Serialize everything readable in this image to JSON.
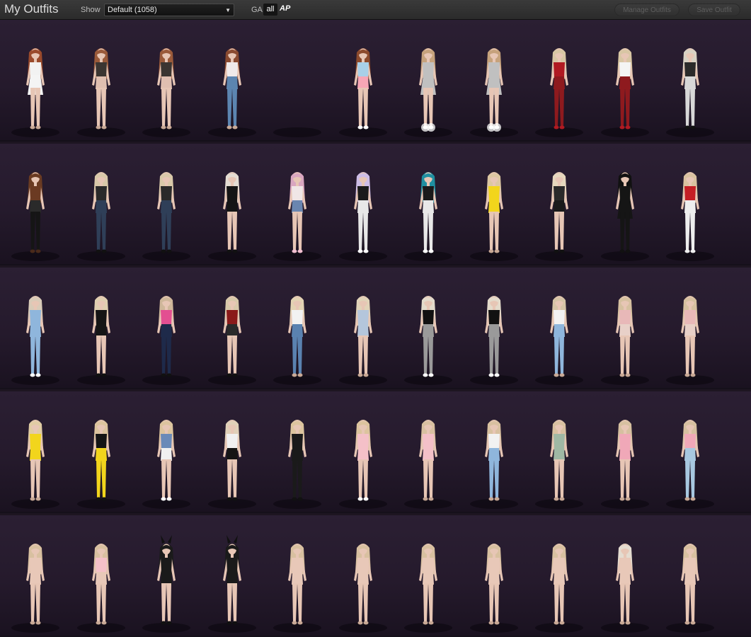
{
  "header": {
    "title": "My Outfits",
    "show_label": "Show",
    "show_value": "Default (1058)",
    "ga_label": "GA",
    "filter_all": "all",
    "filter_ap": "AP",
    "manage_label": "Manage Outfits",
    "save_label": "Save Outfit"
  },
  "colors": {
    "background": "#1d1521",
    "row": "#2b1f33",
    "skin": "#e7c6b5",
    "text": "#dcdcdc"
  },
  "rows": [
    {
      "outfits": [
        {
          "hair": "#9a4a2c",
          "top": "#f2f2f2",
          "bottom": "#f4f4f4",
          "legs": "skin",
          "shoes": "#c9a996",
          "dress": true
        },
        {
          "hair": "#9a5a3a",
          "top": "#3b3531",
          "bottom": "#e0bfb0",
          "legs": "skin",
          "shoes": "#c9a996"
        },
        {
          "hair": "#9a5a3a",
          "top": "#3b3531",
          "bottom": "#e0bfb0",
          "legs": "skin",
          "shoes": "#c9a996"
        },
        {
          "hair": "#8a4a30",
          "top": "#f0eaea",
          "bottom": "#5c85b0",
          "legs": "jeans",
          "shoes": "#c9a996"
        },
        {
          "empty": true
        },
        {
          "hair": "#8c4a2c",
          "top": "#a8d0e8",
          "bottom": "#f7a6b6",
          "legs": "skin",
          "shoes": "#ffffff"
        },
        {
          "hair": "#c6a27c",
          "top": "#c0c0c0",
          "bottom": "#c0c0c0",
          "legs": "skin",
          "shoes": "#ffffff",
          "dress": true,
          "sparkle": true
        },
        {
          "hair": "#c6a27c",
          "top": "#c0c0c0",
          "bottom": "#c0c0c0",
          "legs": "skin",
          "shoes": "#ffffff",
          "dress": true,
          "sparkle": true
        },
        {
          "hair": "#d8c6a4",
          "top": "#b01a22",
          "bottom": "#8e1a1e",
          "legs": "pants",
          "shoes": "#b01a22"
        },
        {
          "hair": "#d8c6a4",
          "top": "#f4f4f4",
          "bottom": "#8e1a1e",
          "legs": "pants",
          "shoes": "#b01a22"
        },
        {
          "hair": "#d8d2c4",
          "top": "#2a2a2a",
          "bottom": "#d8d8d8",
          "legs": "pants",
          "shoes": "#111111"
        }
      ]
    },
    {
      "outfits": [
        {
          "hair": "#6a3b22",
          "top": "#6b3a22",
          "bottom": "#2a2a2a",
          "legs": "dark",
          "shoes": "#4a2a1a"
        },
        {
          "hair": "#d9c9a9",
          "top": "#2a2a2a",
          "bottom": "#2f3f58",
          "legs": "jeans",
          "shoes": "#111111"
        },
        {
          "hair": "#d9c9a9",
          "top": "#2a2a2a",
          "bottom": "#2f3f58",
          "legs": "jeans",
          "shoes": "#111111"
        },
        {
          "hair": "#e4ddd3",
          "top": "#151515",
          "bottom": "#151515",
          "legs": "skin",
          "shoes": "#111111"
        },
        {
          "hair": "#d9a6c0",
          "top": "#f0e6e6",
          "bottom": "#6a86b0",
          "legs": "skin",
          "shoes": "#f2c0d0"
        },
        {
          "hair": "#cdbde6",
          "top": "#1a1a1a",
          "bottom": "#e8e8e8",
          "legs": "pants",
          "shoes": "#ffffff"
        },
        {
          "hair": "#1f8fa0",
          "top": "#1a1a1a",
          "bottom": "#e8e8e8",
          "legs": "pants",
          "shoes": "#ffffff"
        },
        {
          "hair": "#dcc7a2",
          "top": "#f2d51c",
          "bottom": "#f2d51c",
          "legs": "skin",
          "shoes": "#c9a996"
        },
        {
          "hair": "#e6d8be",
          "top": "#2a2a2a",
          "bottom": "#1a1a1a",
          "legs": "skin",
          "shoes": "#111111"
        },
        {
          "hair": "#111111",
          "top": "#151515",
          "bottom": "#151515",
          "legs": "dark",
          "shoes": "#111111",
          "dress": true
        },
        {
          "hair": "#d9c2a0",
          "top": "#c41e25",
          "bottom": "#eeeeee",
          "legs": "pants",
          "shoes": "#eeeeee"
        }
      ]
    },
    {
      "outfits": [
        {
          "hair": "#d9cbb8",
          "top": "#8fb6dc",
          "bottom": "#8fb6dc",
          "legs": "jeans",
          "shoes": "#ffffff"
        },
        {
          "hair": "#e0cfb0",
          "top": "#151515",
          "bottom": "#151515",
          "legs": "skin",
          "shoes": "#111111"
        },
        {
          "hair": "#cfb79a",
          "top": "#e34f91",
          "bottom": "#1e2a4a",
          "legs": "jeans",
          "shoes": "#111111"
        },
        {
          "hair": "#d8c8aa",
          "top": "#8a1a1a",
          "bottom": "#2a2a2a",
          "legs": "skin",
          "shoes": "#111111"
        },
        {
          "hair": "#e3d3b3",
          "top": "#f2f2f2",
          "bottom": "#5a82b0",
          "legs": "jeans",
          "shoes": "#c9a996"
        },
        {
          "hair": "#e1d3b8",
          "top": "#b4c6dc",
          "bottom": "#b4c6dc",
          "legs": "skin",
          "shoes": "#c9a996"
        },
        {
          "hair": "#e4dbcb",
          "top": "#111111",
          "bottom": "#9a9a9a",
          "legs": "pants",
          "shoes": "#ffffff"
        },
        {
          "hair": "#e4dbcb",
          "top": "#111111",
          "bottom": "#9a9a9a",
          "legs": "pants",
          "shoes": "#ffffff"
        },
        {
          "hair": "#d6c4a6",
          "top": "#f2f2f2",
          "bottom": "#8fb6dc",
          "legs": "jeans",
          "shoes": "#c9a996"
        },
        {
          "hair": "#d6c0a0",
          "top": "#e8b8b8",
          "bottom": "#e8d0c8",
          "legs": "skin",
          "shoes": "#c9a996"
        },
        {
          "hair": "#d6c0a0",
          "top": "#e8b8b8",
          "bottom": "#e8d0c8",
          "legs": "skin",
          "shoes": "#c9a996"
        }
      ]
    },
    {
      "outfits": [
        {
          "hair": "#e0cca4",
          "top": "#f2d51c",
          "bottom": "#f2d51c",
          "legs": "skin",
          "shoes": "#c9a996"
        },
        {
          "hair": "#dcc49e",
          "top": "#151515",
          "bottom": "#f2d51c",
          "legs": "pants",
          "shoes": "#111111"
        },
        {
          "hair": "#dcc49e",
          "top": "#6a8ab8",
          "bottom": "#f0f0f0",
          "legs": "skin",
          "shoes": "#ffffff"
        },
        {
          "hair": "#e0d0b8",
          "top": "#f0f0f0",
          "bottom": "#151515",
          "legs": "skin",
          "shoes": "#111111"
        },
        {
          "hair": "#dcc49e",
          "top": "#1a1a1a",
          "bottom": "#1a1a1a",
          "legs": "pants",
          "shoes": "#111111"
        },
        {
          "hair": "#dcc49e",
          "top": "#f4c0c8",
          "bottom": "#f4c0c8",
          "legs": "skin",
          "shoes": "#ffffff"
        },
        {
          "hair": "#d8c0a0",
          "top": "#f4c0c8",
          "bottom": "#f4c0c8",
          "legs": "skin",
          "shoes": "#c9a996"
        },
        {
          "hair": "#d8c0a0",
          "top": "#f2f2f2",
          "bottom": "#8fb6dc",
          "legs": "jeans",
          "shoes": "#c9a996"
        },
        {
          "hair": "#d8c0a0",
          "top": "#9fb8a4",
          "bottom": "#9fb8a4",
          "legs": "skin",
          "shoes": "#c9a996"
        },
        {
          "hair": "#d6c0a0",
          "top": "#f0a8b8",
          "bottom": "#f0a8b8",
          "legs": "skin",
          "shoes": "#c9a996"
        },
        {
          "hair": "#d6c0a0",
          "top": "#f0a8b8",
          "bottom": "#a8c8e0",
          "legs": "pants",
          "shoes": "#c9a996"
        }
      ]
    },
    {
      "outfits": [
        {
          "hair": "#d8c0a0",
          "top": "#e8c8b8",
          "bottom": "#e8c8b8",
          "legs": "skin",
          "shoes": "#c9a996"
        },
        {
          "hair": "#d8c0a0",
          "top": "#f4c0c8",
          "bottom": "#e8c8b8",
          "legs": "skin",
          "shoes": "#c9a996"
        },
        {
          "hair": "#1a1a1a",
          "top": "#1a1a1a",
          "bottom": "#1a1a1a",
          "legs": "skin",
          "shoes": "#111111",
          "ears": true
        },
        {
          "hair": "#1a1a1a",
          "top": "#1a1a1a",
          "bottom": "#1a1a1a",
          "legs": "skin",
          "shoes": "#111111",
          "ears": true
        },
        {
          "hair": "#d8c0a0",
          "top": "#e8c8b8",
          "bottom": "#e8c8b8",
          "legs": "skin",
          "shoes": "#c9a996"
        },
        {
          "hair": "#d8c0a0",
          "top": "#e8c8b8",
          "bottom": "#e8c8b8",
          "legs": "skin",
          "shoes": "#c9a996"
        },
        {
          "hair": "#d8c0a0",
          "top": "#e8c8b8",
          "bottom": "#e8c8b8",
          "legs": "skin",
          "shoes": "#c9a996"
        },
        {
          "hair": "#d8c0a0",
          "top": "#e8c8b8",
          "bottom": "#e8c8b8",
          "legs": "skin",
          "shoes": "#c9a996"
        },
        {
          "hair": "#d8c0a0",
          "top": "#e8c8b8",
          "bottom": "#e8c8b8",
          "legs": "skin",
          "shoes": "#c9a996"
        },
        {
          "hair": "#e4dcd0",
          "top": "#e8c8b8",
          "bottom": "#e8c8b8",
          "legs": "skin",
          "shoes": "#c9a996"
        },
        {
          "hair": "#d8c0a0",
          "top": "#e8c8b8",
          "bottom": "#e8c8b8",
          "legs": "skin",
          "shoes": "#c9a996"
        }
      ]
    }
  ]
}
